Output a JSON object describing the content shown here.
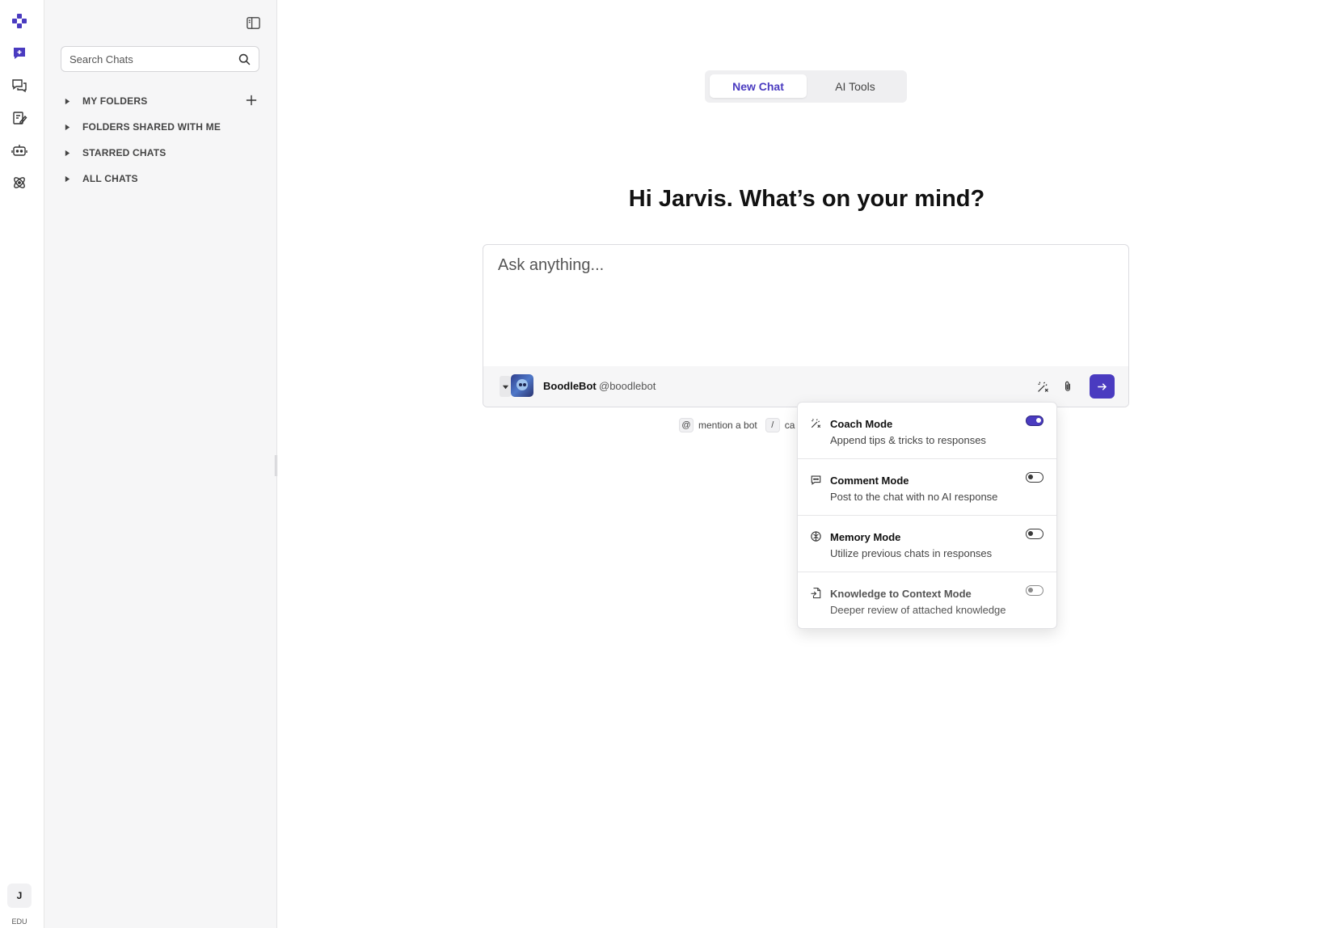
{
  "brand": {
    "accent": "#4a3bc0"
  },
  "rail": {
    "icons": [
      "logo-icon",
      "new-chat-icon",
      "chats-icon",
      "prompts-icon",
      "bots-icon",
      "integrations-icon"
    ],
    "avatar_initial": "J",
    "plan_label": "EDU"
  },
  "sidebar": {
    "search_placeholder": "Search Chats",
    "folders": [
      {
        "label": "MY FOLDERS"
      },
      {
        "label": "FOLDERS SHARED WITH ME"
      },
      {
        "label": "STARRED CHATS"
      },
      {
        "label": "ALL CHATS"
      }
    ]
  },
  "main": {
    "tabs": [
      {
        "label": "New Chat",
        "active": true
      },
      {
        "label": "AI Tools",
        "active": false
      }
    ],
    "greeting": "Hi Jarvis. What’s on your mind?",
    "composer": {
      "placeholder": "Ask anything...",
      "bot_name": "BoodleBot",
      "bot_handle": "@boodlebot"
    },
    "hints": [
      {
        "key": "@",
        "text": "mention a bot"
      },
      {
        "key": "/",
        "text": "ca"
      }
    ]
  },
  "modes_menu": {
    "items": [
      {
        "icon": "coach-mode-icon",
        "title": "Coach Mode",
        "description": "Append tips & tricks to responses",
        "enabled": true
      },
      {
        "icon": "comment-mode-icon",
        "title": "Comment Mode",
        "description": "Post to the chat with no AI response",
        "enabled": false
      },
      {
        "icon": "memory-mode-icon",
        "title": "Memory Mode",
        "description": "Utilize previous chats in responses",
        "enabled": false
      },
      {
        "icon": "knowledge-mode-icon",
        "title": "Knowledge to Context Mode",
        "description": "Deeper review of attached knowledge",
        "enabled": false
      }
    ]
  }
}
